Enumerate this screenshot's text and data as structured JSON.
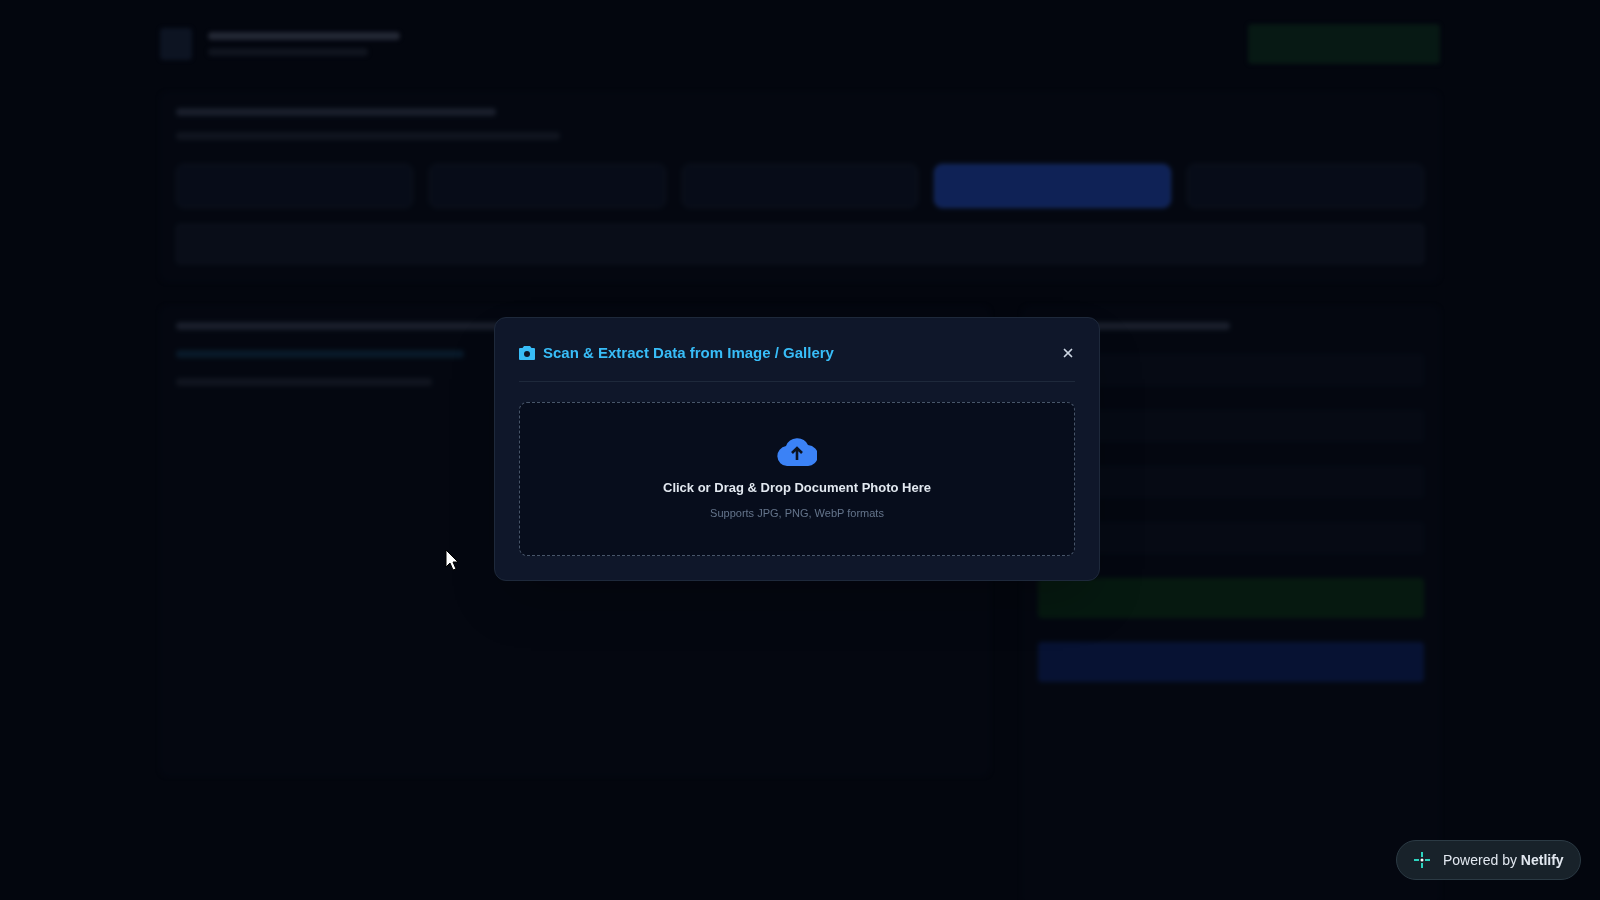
{
  "background": {
    "tabs": [
      {
        "selected": false
      },
      {
        "selected": false
      },
      {
        "selected": false
      },
      {
        "selected": true
      },
      {
        "selected": false
      }
    ]
  },
  "modal": {
    "title": "Scan & Extract Data from Image / Gallery",
    "dropzone": {
      "title": "Click or Drag & Drop Document Photo Here",
      "hint": "Supports JPG, PNG, WebP formats"
    }
  },
  "badge": {
    "text": "Powered by **Netlify**"
  }
}
